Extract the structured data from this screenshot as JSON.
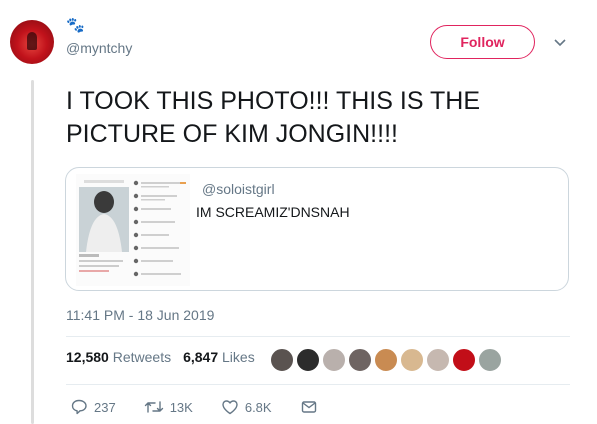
{
  "tweet": {
    "handle": "@myntchy",
    "follow_label": "Follow",
    "text": "I TOOK THIS PHOTO!!! THIS IS THE PICTURE OF KIM JONGIN!!!!",
    "quote": {
      "user": "@soloistgirl",
      "text": "IM SCREAMIZ'DNSNAH"
    },
    "timestamp": "11:41 PM - 18 Jun 2019",
    "stats": {
      "retweets_count": "12,580",
      "retweets_label": "Retweets",
      "likes_count": "6,847",
      "likes_label": "Likes"
    },
    "actions": {
      "replies": "237",
      "retweets": "13K",
      "likes": "6.8K"
    }
  },
  "colors": {
    "accent": "#e0245e",
    "muted": "#657786",
    "border": "#ccd6dd"
  },
  "icons": [
    "paw-prints-icon",
    "chevron-down-icon",
    "reply-icon",
    "retweet-icon",
    "heart-icon",
    "message-icon"
  ]
}
